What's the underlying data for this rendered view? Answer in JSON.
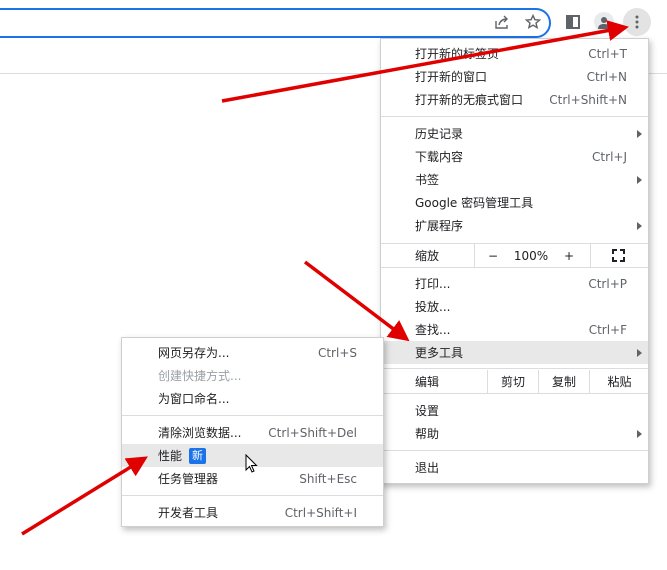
{
  "toolbar": {
    "icons": [
      "share-icon",
      "star-icon",
      "side-panel-icon",
      "profile-icon",
      "more-vert-icon"
    ]
  },
  "main_menu": {
    "items": [
      {
        "label": "打开新的标签页",
        "shortcut": "Ctrl+T"
      },
      {
        "label": "打开新的窗口",
        "shortcut": "Ctrl+N"
      },
      {
        "label": "打开新的无痕式窗口",
        "shortcut": "Ctrl+Shift+N"
      },
      {
        "label": "历史记录",
        "submenu": true
      },
      {
        "label": "下载内容",
        "shortcut": "Ctrl+J"
      },
      {
        "label": "书签",
        "submenu": true
      },
      {
        "label": "Google 密码管理工具"
      },
      {
        "label": "扩展程序",
        "submenu": true
      },
      {
        "label": "打印...",
        "shortcut": "Ctrl+P"
      },
      {
        "label": "投放..."
      },
      {
        "label": "查找...",
        "shortcut": "Ctrl+F"
      },
      {
        "label": "更多工具",
        "submenu": true,
        "highlighted": true
      },
      {
        "label": "设置"
      },
      {
        "label": "帮助",
        "submenu": true
      },
      {
        "label": "退出"
      }
    ],
    "zoom": {
      "label": "缩放",
      "minus": "−",
      "value": "100%",
      "plus": "+"
    },
    "edit": {
      "label": "编辑",
      "cut": "剪切",
      "copy": "复制",
      "paste": "粘贴"
    }
  },
  "more_tools_menu": {
    "items": [
      {
        "label": "网页另存为...",
        "shortcut": "Ctrl+S"
      },
      {
        "label": "创建快捷方式...",
        "disabled": true
      },
      {
        "label": "为窗口命名..."
      },
      {
        "label": "清除浏览数据...",
        "shortcut": "Ctrl+Shift+Del"
      },
      {
        "label": "性能",
        "badge": "新",
        "highlighted": true
      },
      {
        "label": "任务管理器",
        "shortcut": "Shift+Esc"
      },
      {
        "label": "开发者工具",
        "shortcut": "Ctrl+Shift+I"
      }
    ]
  },
  "colors": {
    "accent": "#1a73e8",
    "annotation_arrow": "#e00000",
    "highlight": "#e8e8e8"
  }
}
